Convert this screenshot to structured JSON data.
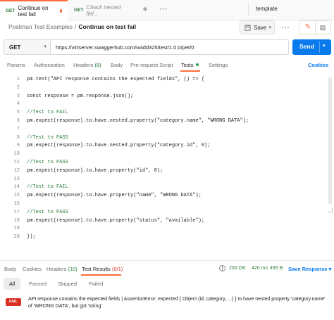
{
  "tabs": [
    {
      "method": "GET",
      "name": "Continue on test fail",
      "active": true,
      "unsaved": true
    },
    {
      "method": "GET",
      "name": "Check nested fiel...",
      "active": false
    }
  ],
  "tabbar": {
    "add": "+",
    "more": "⋯",
    "environment": "template"
  },
  "breadcrumb": {
    "parent": "Postman Test Examples",
    "separator": "/",
    "current": "Continue on test fail"
  },
  "toolbar": {
    "save_label": "Save",
    "more": "⋯",
    "edit_icon": "edit-icon",
    "doc_icon": "doc-icon"
  },
  "request": {
    "method": "GET",
    "url": "https://virtserver.swaggerhub.com/w4dd325/test/1.0.0/pet/0",
    "send_label": "Send"
  },
  "request_tabs": [
    {
      "label": "Params"
    },
    {
      "label": "Authorization"
    },
    {
      "label": "Headers",
      "count": "(8)"
    },
    {
      "label": "Body"
    },
    {
      "label": "Pre-request Script"
    },
    {
      "label": "Tests",
      "active": true
    },
    {
      "label": "Settings"
    }
  ],
  "cookies_label": "Cookies",
  "editor": {
    "lines": [
      {
        "n": "1",
        "text": "pm.test(\"API response contains the expected fields\", () => {",
        "type": "code"
      },
      {
        "n": "2",
        "text": "",
        "type": "code"
      },
      {
        "n": "3",
        "text": "const response = pm.response.json();",
        "type": "code"
      },
      {
        "n": "4",
        "text": "",
        "type": "code"
      },
      {
        "n": "5",
        "text": "//Test to FAIL",
        "type": "comment"
      },
      {
        "n": "6",
        "text": "pm.expect(response).to.have.nested.property(\"category.name\", \"WRONG DATA\");",
        "type": "code"
      },
      {
        "n": "7",
        "text": "",
        "type": "code"
      },
      {
        "n": "8",
        "text": "//Test to PASS",
        "type": "comment"
      },
      {
        "n": "9",
        "text": "pm.expect(response).to.have.nested.property(\"category.id\", 0);",
        "type": "code"
      },
      {
        "n": "10",
        "text": "",
        "type": "code"
      },
      {
        "n": "11",
        "text": "//Test to PASS",
        "type": "comment"
      },
      {
        "n": "12",
        "text": "pm.expect(response).to.have.property(\"id\", 0);",
        "type": "code"
      },
      {
        "n": "13",
        "text": "",
        "type": "code"
      },
      {
        "n": "14",
        "text": "//Test to FAIL",
        "type": "comment"
      },
      {
        "n": "15",
        "text": "pm.expect(response).to.have.property(\"name\", \"WRONG DATA\");",
        "type": "code"
      },
      {
        "n": "16",
        "text": "",
        "type": "code"
      },
      {
        "n": "17",
        "text": "//Test to PASS",
        "type": "comment"
      },
      {
        "n": "18",
        "text": "pm.expect(response).to.have.property(\"status\", \"available\");",
        "type": "code"
      },
      {
        "n": "19",
        "text": "",
        "type": "code"
      },
      {
        "n": "20",
        "text": "});",
        "type": "code"
      }
    ]
  },
  "response_tabs": [
    {
      "label": "Body"
    },
    {
      "label": "Cookies"
    },
    {
      "label": "Headers",
      "count": "(10)"
    },
    {
      "label": "Test Results",
      "count": "(0/1)",
      "active": true
    }
  ],
  "response_status": {
    "code": "200 OK",
    "time": "420 ms",
    "size": "495 B",
    "save_label": "Save Response"
  },
  "filters": [
    "All",
    "Passed",
    "Skipped",
    "Failed"
  ],
  "results": [
    {
      "status": "FAIL",
      "message": "API response contains the expected fields | AssertionError: expected { Object (id, category, ...) } to have nested property 'category.name' of 'WRONG DATA', but got 'string'"
    }
  ],
  "colors": {
    "accent": "#ff6c37",
    "primary": "#097bed",
    "success": "#2a7d3a",
    "fail": "#d93025"
  }
}
